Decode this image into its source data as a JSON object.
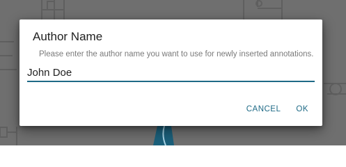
{
  "dialog": {
    "title": "Author Name",
    "message": "Please enter the author name you want to use for newly inserted annotations.",
    "input_value": "John Doe",
    "cancel_label": "CANCEL",
    "ok_label": "OK"
  },
  "colors": {
    "accent": "#1e6a86",
    "backdrop": "#6f6f6f"
  }
}
